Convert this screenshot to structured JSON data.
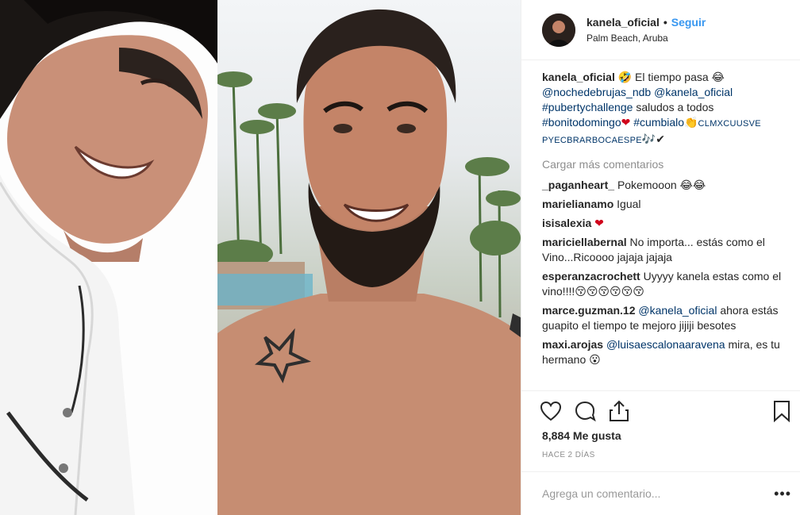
{
  "post": {
    "username": "kanela_oficial",
    "dot": "•",
    "follow_label": "Seguir",
    "location": "Palm Beach, Aruba",
    "caption": {
      "user": "kanela_oficial",
      "text1": "🤣 El tiempo pasa 😂",
      "mention1": "@nochedebrujas_ndb",
      "mention2": "@kanela_oficial",
      "hashtag1": "#pubertychallenge",
      "text2": "saludos a todos",
      "hashtag2": "#bonitodomingo",
      "emoji_heart": "❤",
      "hashtag3": "#cumbialo",
      "emoji_clap": "👏",
      "tags_upper": "CLMXCUUSVE PYECBRARBOCAESPE",
      "emoji_end": "🎶✔"
    },
    "load_more": "Cargar más comentarios",
    "comments": [
      {
        "user": "_paganheart_",
        "text": "Pokemooon 😂😂"
      },
      {
        "user": "marielianamo",
        "text": "Igual"
      },
      {
        "user": "isisalexia",
        "text": "❤"
      },
      {
        "user": "mariciellabernal",
        "text": "No importa... estás como el Vino...Ricoooo jajaja jajaja"
      },
      {
        "user": "esperanzacrochett",
        "text": "Uyyyy kanela estas como el vino!!!!😚😚😚😚😚😚"
      },
      {
        "user": "marce.guzman.12",
        "mention": "@kanela_oficial",
        "text": "ahora estás guapito el tiempo te mejoro jijiji besotes"
      },
      {
        "user": "maxi.arojas",
        "mention": "@luisaescalonaaravena",
        "text": "mira, es tu hermano 😮"
      }
    ],
    "likes": "8,884 Me gusta",
    "time_ago": "HACE 2 DÍAS",
    "comment_placeholder": "Agrega un comentario...",
    "more_options": "•••",
    "icons": [
      "heart-icon",
      "comment-icon",
      "share-icon",
      "bookmark-icon"
    ],
    "colors": {
      "link": "#003569",
      "follow": "#3897f0",
      "muted": "#8e8e8e",
      "heart": "#d0021b"
    }
  }
}
